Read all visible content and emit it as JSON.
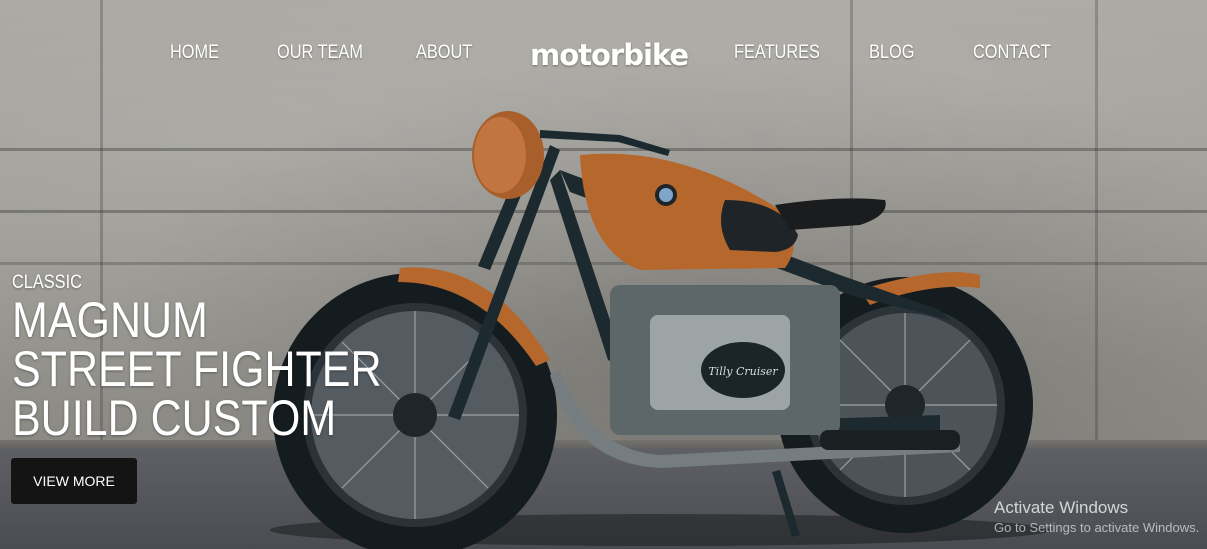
{
  "nav": {
    "items": [
      {
        "label": "HOME"
      },
      {
        "label": "OUR TEAM"
      },
      {
        "label": "ABOUT"
      },
      {
        "label": "FEATURES"
      },
      {
        "label": "BLOG"
      },
      {
        "label": "CONTACT"
      }
    ],
    "logo": "motorbike"
  },
  "hero": {
    "tag": "CLASSIC",
    "lines": [
      "MAGNUM",
      "STREET FIGHTER",
      "BUILD CUSTOM"
    ],
    "button_label": "VIEW MORE"
  },
  "bike": {
    "badge": "Tilly Cruiser"
  },
  "watermark": {
    "title": "Activate Windows",
    "subtitle": "Go to Settings to activate Windows."
  },
  "colors": {
    "tank": "#b5672c",
    "frame": "#1c2a30",
    "button_bg": "#141414"
  }
}
